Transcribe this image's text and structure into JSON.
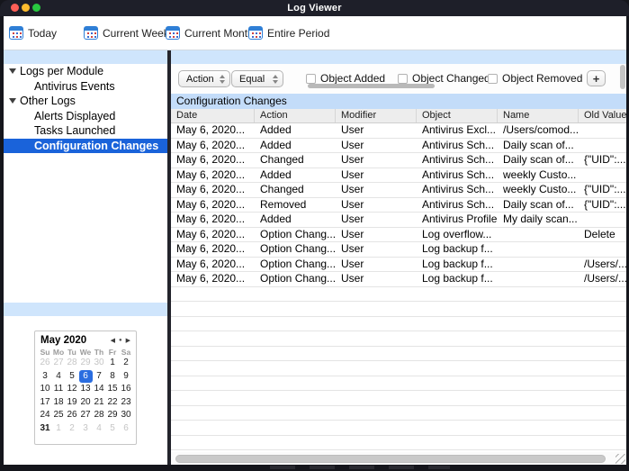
{
  "window": {
    "title": "Log Viewer"
  },
  "colors": {
    "accent_blue": "#1a63da",
    "light_blue_strip": "#cfe5fc",
    "table_title_band": "#c3dcf9",
    "titlebar_bg": "#1e1f29",
    "selected_day_blue": "#2a6de0"
  },
  "toolbar": {
    "items": [
      {
        "label": "Today"
      },
      {
        "label": "Current Week"
      },
      {
        "label": "Current Month"
      },
      {
        "label": "Entire Period"
      }
    ]
  },
  "sidebar": {
    "tree": [
      {
        "label": "Logs per Module",
        "level": 0,
        "expandable": true,
        "selected": false
      },
      {
        "label": "Antivirus Events",
        "level": 1,
        "expandable": false,
        "selected": false
      },
      {
        "label": "Other Logs",
        "level": 0,
        "expandable": true,
        "selected": false
      },
      {
        "label": "Alerts Displayed",
        "level": 1,
        "expandable": false,
        "selected": false
      },
      {
        "label": "Tasks Launched",
        "level": 1,
        "expandable": false,
        "selected": false
      },
      {
        "label": "Configuration Changes",
        "level": 1,
        "expandable": false,
        "selected": true
      }
    ],
    "calendar": {
      "title": "May 2020",
      "day_headers": [
        "Su",
        "Mo",
        "Tu",
        "We",
        "Th",
        "Fr",
        "Sa"
      ],
      "weeks": [
        [
          {
            "d": "26",
            "muted": true
          },
          {
            "d": "27",
            "muted": true
          },
          {
            "d": "28",
            "muted": true
          },
          {
            "d": "29",
            "muted": true
          },
          {
            "d": "30",
            "muted": true
          },
          {
            "d": "1"
          },
          {
            "d": "2"
          }
        ],
        [
          {
            "d": "3"
          },
          {
            "d": "4"
          },
          {
            "d": "5"
          },
          {
            "d": "6",
            "selected": true
          },
          {
            "d": "7"
          },
          {
            "d": "8"
          },
          {
            "d": "9"
          }
        ],
        [
          {
            "d": "10"
          },
          {
            "d": "11"
          },
          {
            "d": "12"
          },
          {
            "d": "13"
          },
          {
            "d": "14"
          },
          {
            "d": "15"
          },
          {
            "d": "16"
          }
        ],
        [
          {
            "d": "17"
          },
          {
            "d": "18"
          },
          {
            "d": "19"
          },
          {
            "d": "20"
          },
          {
            "d": "21"
          },
          {
            "d": "22"
          },
          {
            "d": "23"
          }
        ],
        [
          {
            "d": "24"
          },
          {
            "d": "25"
          },
          {
            "d": "26"
          },
          {
            "d": "27"
          },
          {
            "d": "28"
          },
          {
            "d": "29"
          },
          {
            "d": "30"
          }
        ],
        [
          {
            "d": "31",
            "bold": true
          },
          {
            "d": "1",
            "muted": true
          },
          {
            "d": "2",
            "muted": true
          },
          {
            "d": "3",
            "muted": true
          },
          {
            "d": "4",
            "muted": true
          },
          {
            "d": "5",
            "muted": true
          },
          {
            "d": "6",
            "muted": true
          }
        ]
      ],
      "selected_day": "6"
    }
  },
  "filters": {
    "field_select_value": "Action",
    "operator_select_value": "Equal",
    "checkboxes": [
      {
        "label": "Object Added",
        "checked": false
      },
      {
        "label": "Object Changed",
        "checked": false
      },
      {
        "label": "Object Removed",
        "checked": false
      }
    ],
    "add_button_label": "+"
  },
  "table": {
    "title": "Configuration Changes",
    "columns": [
      "Date",
      "Action",
      "Modifier",
      "Object",
      "Name",
      "Old Value"
    ],
    "rows": [
      [
        "May 6, 2020...",
        "Added",
        "User",
        "Antivirus Excl...",
        "/Users/comod...",
        ""
      ],
      [
        "May 6, 2020...",
        "Added",
        "User",
        "Antivirus Sch...",
        "Daily scan of...",
        ""
      ],
      [
        "May 6, 2020...",
        "Changed",
        "User",
        "Antivirus Sch...",
        "Daily scan of...",
        "{\"UID\":..."
      ],
      [
        "May 6, 2020...",
        "Added",
        "User",
        "Antivirus Sch...",
        "weekly Custo...",
        ""
      ],
      [
        "May 6, 2020...",
        "Changed",
        "User",
        "Antivirus Sch...",
        "weekly Custo...",
        "{\"UID\":..."
      ],
      [
        "May 6, 2020...",
        "Removed",
        "User",
        "Antivirus Sch...",
        "Daily scan of...",
        "{\"UID\":..."
      ],
      [
        "May 6, 2020...",
        "Added",
        "User",
        "Antivirus Profile",
        "My daily scan...",
        ""
      ],
      [
        "May 6, 2020...",
        "Option Chang...",
        "User",
        "Log overflow...",
        "",
        "Delete"
      ],
      [
        "May 6, 2020...",
        "Option Chang...",
        "User",
        "Log backup f...",
        "",
        ""
      ],
      [
        "May 6, 2020...",
        "Option Chang...",
        "User",
        "Log backup f...",
        "",
        "/Users/..."
      ],
      [
        "May 6, 2020...",
        "Option Chang...",
        "User",
        "Log backup f...",
        "",
        "/Users/..."
      ]
    ],
    "empty_row_count": 12
  }
}
